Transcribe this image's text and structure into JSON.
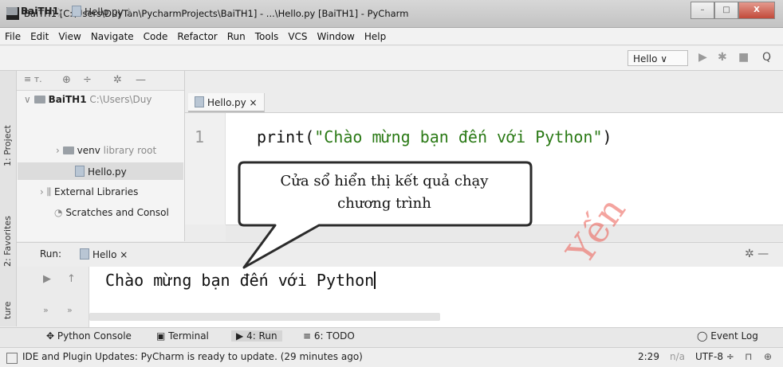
{
  "window": {
    "title": "BaiTH1 [C:\\Users\\DuyTan\\PycharmProjects\\BaiTH1] - ...\\Hello.py [BaiTH1] - PyCharm",
    "app_icon": "PC",
    "minimize": "–",
    "maximize": "□",
    "close": "X"
  },
  "menu": [
    "File",
    "Edit",
    "View",
    "Navigate",
    "Code",
    "Refactor",
    "Run",
    "Tools",
    "VCS",
    "Window",
    "Help"
  ],
  "breadcrumb": {
    "project": "BaiTH1",
    "file": "Hello.py"
  },
  "toolbar": {
    "run_config": "Hello ∨",
    "run_icon": "▶",
    "debug_icon": "✱",
    "stop_icon": "■",
    "search_icon": "Q"
  },
  "left_strip": {
    "project_tab": "1: Project",
    "favorites_tab": "2: Favorites",
    "structure_tab": "ture"
  },
  "project_panel": {
    "toolbar_icons": [
      "≡ ᴛ.",
      "⊕",
      "÷",
      "✲",
      "—"
    ],
    "tree": {
      "root_name": "BaiTH1",
      "root_path": "C:\\Users\\Duy",
      "venv_name": "venv",
      "venv_note": "library root",
      "file": "Hello.py",
      "external": "External Libraries",
      "scratches": "Scratches and Consol"
    }
  },
  "editor": {
    "tab": "Hello.py ×",
    "line_number": "1",
    "code_prefix": "print(",
    "code_string": "\"Chào mừng bạn đến với Python\"",
    "code_suffix": ")"
  },
  "run_panel": {
    "label": "Run:",
    "config_tab": "Hello ×",
    "settings_icon": "✲ —",
    "output": "Chào mừng bạn đến với Python",
    "left_icons": [
      "▶",
      "↑",
      "»",
      "»"
    ]
  },
  "callout": {
    "line1": "Cửa sổ hiển thị kết quả chạy",
    "line2": "chương trình"
  },
  "bottom_tabs": [
    "Python Console",
    "Terminal",
    "4: Run",
    "6: TODO"
  ],
  "bottom_tab_icons": [
    "✥",
    "▣",
    "▶",
    "≡"
  ],
  "event_log": "Event Log",
  "status": {
    "message": "IDE and Plugin Updates: PyCharm is ready to update. (29 minutes ago)",
    "position": "2:29",
    "na": "n/a",
    "encoding": "UTF-8 ÷"
  },
  "watermark": "Yến",
  "colors": {
    "string": "#2b7a16",
    "watermark": "#eb5a50",
    "close_button": "#c24a3a"
  }
}
